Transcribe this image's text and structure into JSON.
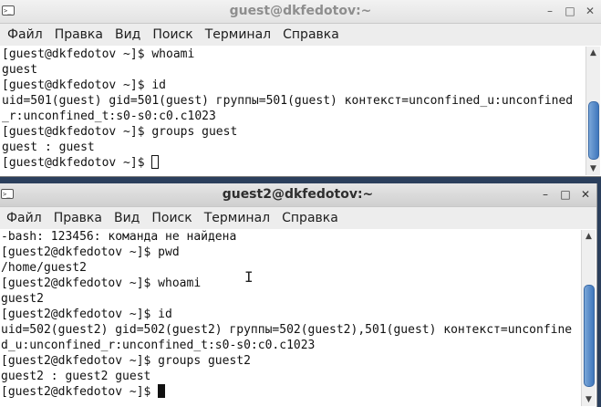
{
  "window1": {
    "title": "guest@dkfedotov:~",
    "controls": {
      "minimize": "–",
      "maximize": "□",
      "close": "✕"
    },
    "menu": [
      "Файл",
      "Правка",
      "Вид",
      "Поиск",
      "Терминал",
      "Справка"
    ],
    "lines": [
      "[guest@dkfedotov ~]$ whoami",
      "guest",
      "[guest@dkfedotov ~]$ id",
      "uid=501(guest) gid=501(guest) группы=501(guest) контекст=unconfined_u:unconfined",
      "_r:unconfined_t:s0-s0:c0.c1023",
      "[guest@dkfedotov ~]$ groups guest",
      "guest : guest"
    ],
    "prompt": "[guest@dkfedotov ~]$ "
  },
  "window2": {
    "title": "guest2@dkfedotov:~",
    "controls": {
      "minimize": "–",
      "maximize": "□",
      "close": "✕"
    },
    "menu": [
      "Файл",
      "Правка",
      "Вид",
      "Поиск",
      "Терминал",
      "Справка"
    ],
    "lines": [
      "-bash: 123456: команда не найдена",
      "[guest2@dkfedotov ~]$ pwd",
      "/home/guest2",
      "[guest2@dkfedotov ~]$ whoami",
      "guest2",
      "[guest2@dkfedotov ~]$ id",
      "uid=502(guest2) gid=502(guest2) группы=502(guest2),501(guest) контекст=unconfine",
      "d_u:unconfined_r:unconfined_t:s0-s0:c0.c1023",
      "[guest2@dkfedotov ~]$ groups guest2",
      "guest2 : guest2 guest"
    ],
    "prompt": "[guest2@dkfedotov ~]$ "
  },
  "icons": {
    "terminal": "terminal-icon",
    "scroll_up": "▲",
    "scroll_down": "▼",
    "ibeam": "Ι"
  }
}
